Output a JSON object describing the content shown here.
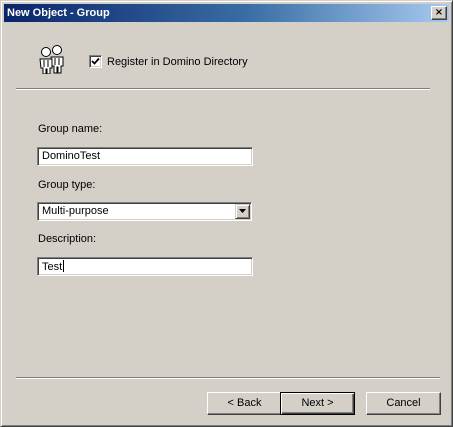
{
  "window": {
    "title": "New Object - Group",
    "close_glyph": "×"
  },
  "header": {
    "icon": "group-icon",
    "register_checkbox": {
      "label": "Register in Domino Directory",
      "checked": true
    }
  },
  "form": {
    "group_name": {
      "label": "Group name:",
      "value": "DominoTest"
    },
    "group_type": {
      "label": "Group type:",
      "selected": "Multi-purpose"
    },
    "description": {
      "label": "Description:",
      "value": "Test"
    }
  },
  "buttons": {
    "back_label": "< Back",
    "next_label": "Next >",
    "cancel_label": "Cancel"
  },
  "colors": {
    "title_gradient_start": "#0a246a",
    "title_gradient_end": "#a6caf0",
    "dialog_face": "#d4d0c8"
  }
}
